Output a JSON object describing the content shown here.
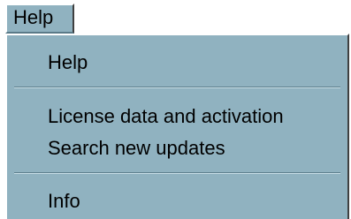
{
  "menubar": {
    "help_label": "Help"
  },
  "menu": {
    "items": [
      {
        "label": "Help"
      },
      {
        "label": "License data and activation"
      },
      {
        "label": "Search new updates"
      },
      {
        "label": "Info"
      }
    ]
  }
}
